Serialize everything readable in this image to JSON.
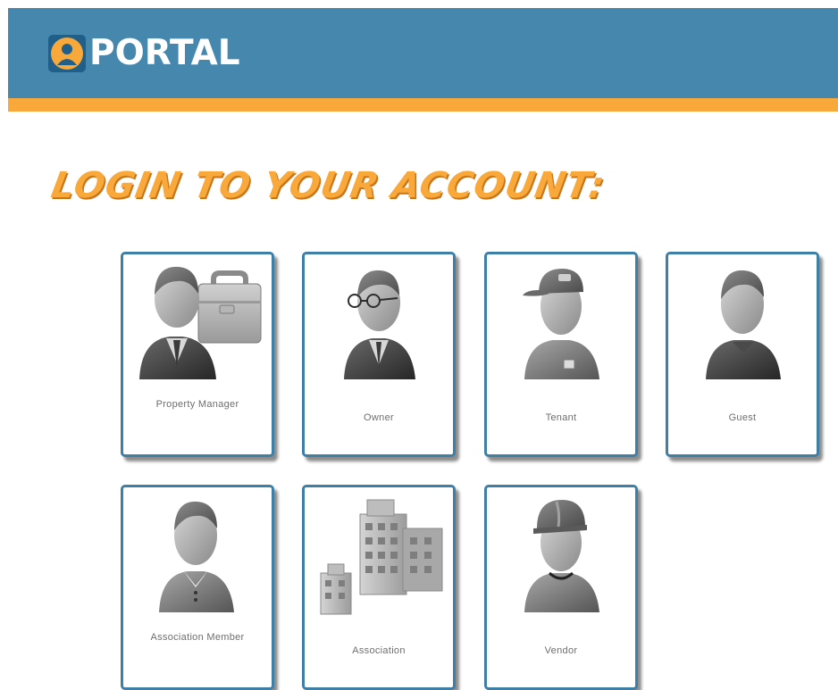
{
  "header": {
    "logo_text": "PORTAL",
    "background_color": "#4688ad",
    "stripe_color": "#f9a83a"
  },
  "main": {
    "title": "LOGIN TO YOUR ACCOUNT:",
    "title_color": "#f9a83a"
  },
  "login_options": [
    {
      "label": "Property Manager",
      "icon": "property-manager-icon"
    },
    {
      "label": "Owner",
      "icon": "owner-icon"
    },
    {
      "label": "Tenant",
      "icon": "tenant-icon"
    },
    {
      "label": "Guest",
      "icon": "guest-icon"
    },
    {
      "label": "Association Member",
      "icon": "association-member-icon"
    },
    {
      "label": "Association",
      "icon": "association-icon"
    },
    {
      "label": "Vendor",
      "icon": "vendor-icon"
    }
  ]
}
